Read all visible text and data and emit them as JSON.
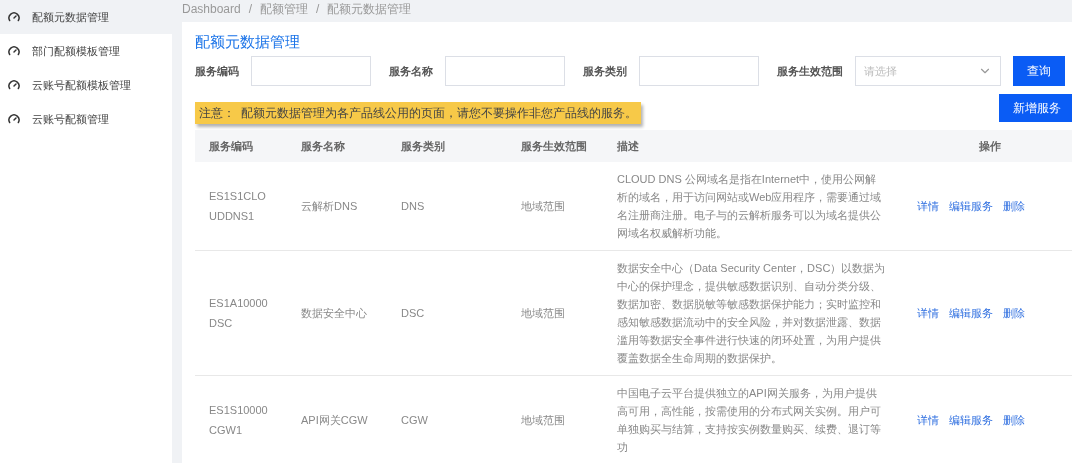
{
  "sidebar": {
    "items": [
      {
        "label": "配额元数据管理",
        "selected": true
      },
      {
        "label": "部门配额模板管理",
        "selected": false
      },
      {
        "label": "云账号配额模板管理",
        "selected": false
      },
      {
        "label": "云账号配额管理",
        "selected": false
      }
    ]
  },
  "breadcrumb": [
    "Dashboard",
    "配额管理",
    "配额元数据管理"
  ],
  "breadcrumb_separator": "/",
  "page_title": "配额元数据管理",
  "filters": [
    {
      "kind": "input",
      "label": "服务编码"
    },
    {
      "kind": "input",
      "label": "服务名称"
    },
    {
      "kind": "input",
      "label": "服务类别"
    },
    {
      "kind": "select",
      "label": "服务生效范围",
      "placeholder": "请选择"
    }
  ],
  "search_button": "查询",
  "add_button": "新增服务",
  "notice": {
    "label": "注意：",
    "text": "配额元数据管理为各产品线公用的页面，请您不要操作非您产品线的服务。"
  },
  "table": {
    "columns": [
      "服务编码",
      "服务名称",
      "服务类别",
      "服务生效范围",
      "描述",
      "操作"
    ],
    "rows": [
      {
        "code": "ES1S1CLOUDDNS1",
        "name": "云解析DNS",
        "type": "DNS",
        "scope": "地域范围",
        "description": "CLOUD DNS 公网域名是指在Internet中，使用公网解析的域名，用于访问网站或Web应用程序，需要通过域名注册商注册。电子与的云解析服务可以为域名提供公网域名权威解析功能。",
        "actions": [
          "详情",
          "编辑服务",
          "删除"
        ]
      },
      {
        "code": "ES1A10000DSC",
        "name": "数据安全中心",
        "type": "DSC",
        "scope": "地域范围",
        "description": "数据安全中心（Data Security Center，DSC）以数据为中心的保护理念，提供敏感数据识别、自动分类分级、数据加密、数据脱敏等敏感数据保护能力；实时监控和感知敏感数据流动中的安全风险，并对数据泄露、数据滥用等数据安全事件进行快速的闭环处置，为用户提供覆盖数据全生命周期的数据保护。",
        "actions": [
          "详情",
          "编辑服务",
          "删除"
        ]
      },
      {
        "code": "ES1S10000CGW1",
        "name": "API网关CGW",
        "type": "CGW",
        "scope": "地域范围",
        "description": "中国电子云平台提供独立的API网关服务，为用户提供高可用，高性能，按需使用的分布式网关实例。用户可单独购买与结算，支持按实例数量购买、续费、退订等功",
        "actions": [
          "详情",
          "编辑服务",
          "删除"
        ]
      }
    ]
  }
}
